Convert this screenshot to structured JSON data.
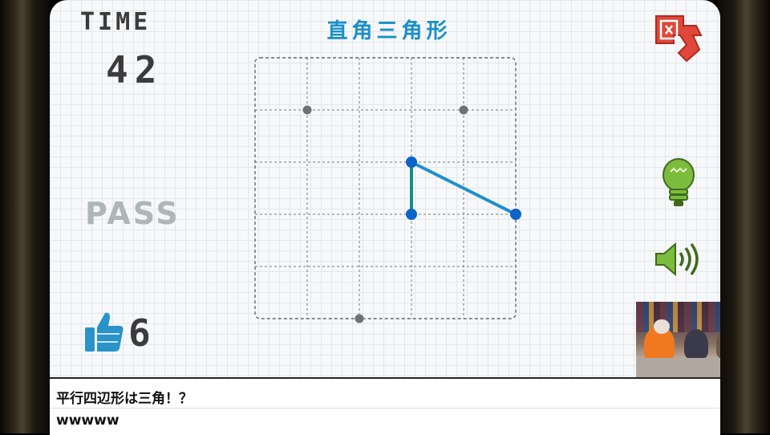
{
  "game": {
    "title": "直角三角形",
    "time_label": "TIME",
    "time_value": "42",
    "pass_label": "PASS",
    "likes": "6"
  },
  "board": {
    "grid_columns": 5,
    "grid_rows": 5,
    "border_style": "dashed",
    "dots": [
      {
        "col": 1,
        "row": 1,
        "kind": "gray"
      },
      {
        "col": 4,
        "row": 1,
        "kind": "gray"
      },
      {
        "col": 2,
        "row": 5,
        "kind": "gray"
      },
      {
        "col": 3,
        "row": 2,
        "kind": "blue"
      },
      {
        "col": 3,
        "row": 3,
        "kind": "blue"
      },
      {
        "col": 5,
        "row": 3,
        "kind": "blue"
      }
    ],
    "segments": [
      {
        "from": [
          3,
          2
        ],
        "to": [
          3,
          3
        ],
        "color": "#138c8c"
      },
      {
        "from": [
          3,
          2
        ],
        "to": [
          5,
          3
        ],
        "color": "#1f8fd0"
      }
    ]
  },
  "chat": {
    "messages": [
      "平行四辺形は三角！？",
      "wwwww"
    ]
  },
  "colors": {
    "accent_blue": "#1f8fd0",
    "teal": "#138c8c",
    "dot_blue": "#0c64c8",
    "dot_gray": "#707070",
    "logo_red": "#e0463a",
    "bulb_green": "#7cbc3c",
    "thumb_blue": "#2a93c9"
  },
  "icons": [
    "logo-icon",
    "hint-bulb-icon",
    "sound-icon",
    "thumbs-up-icon"
  ]
}
